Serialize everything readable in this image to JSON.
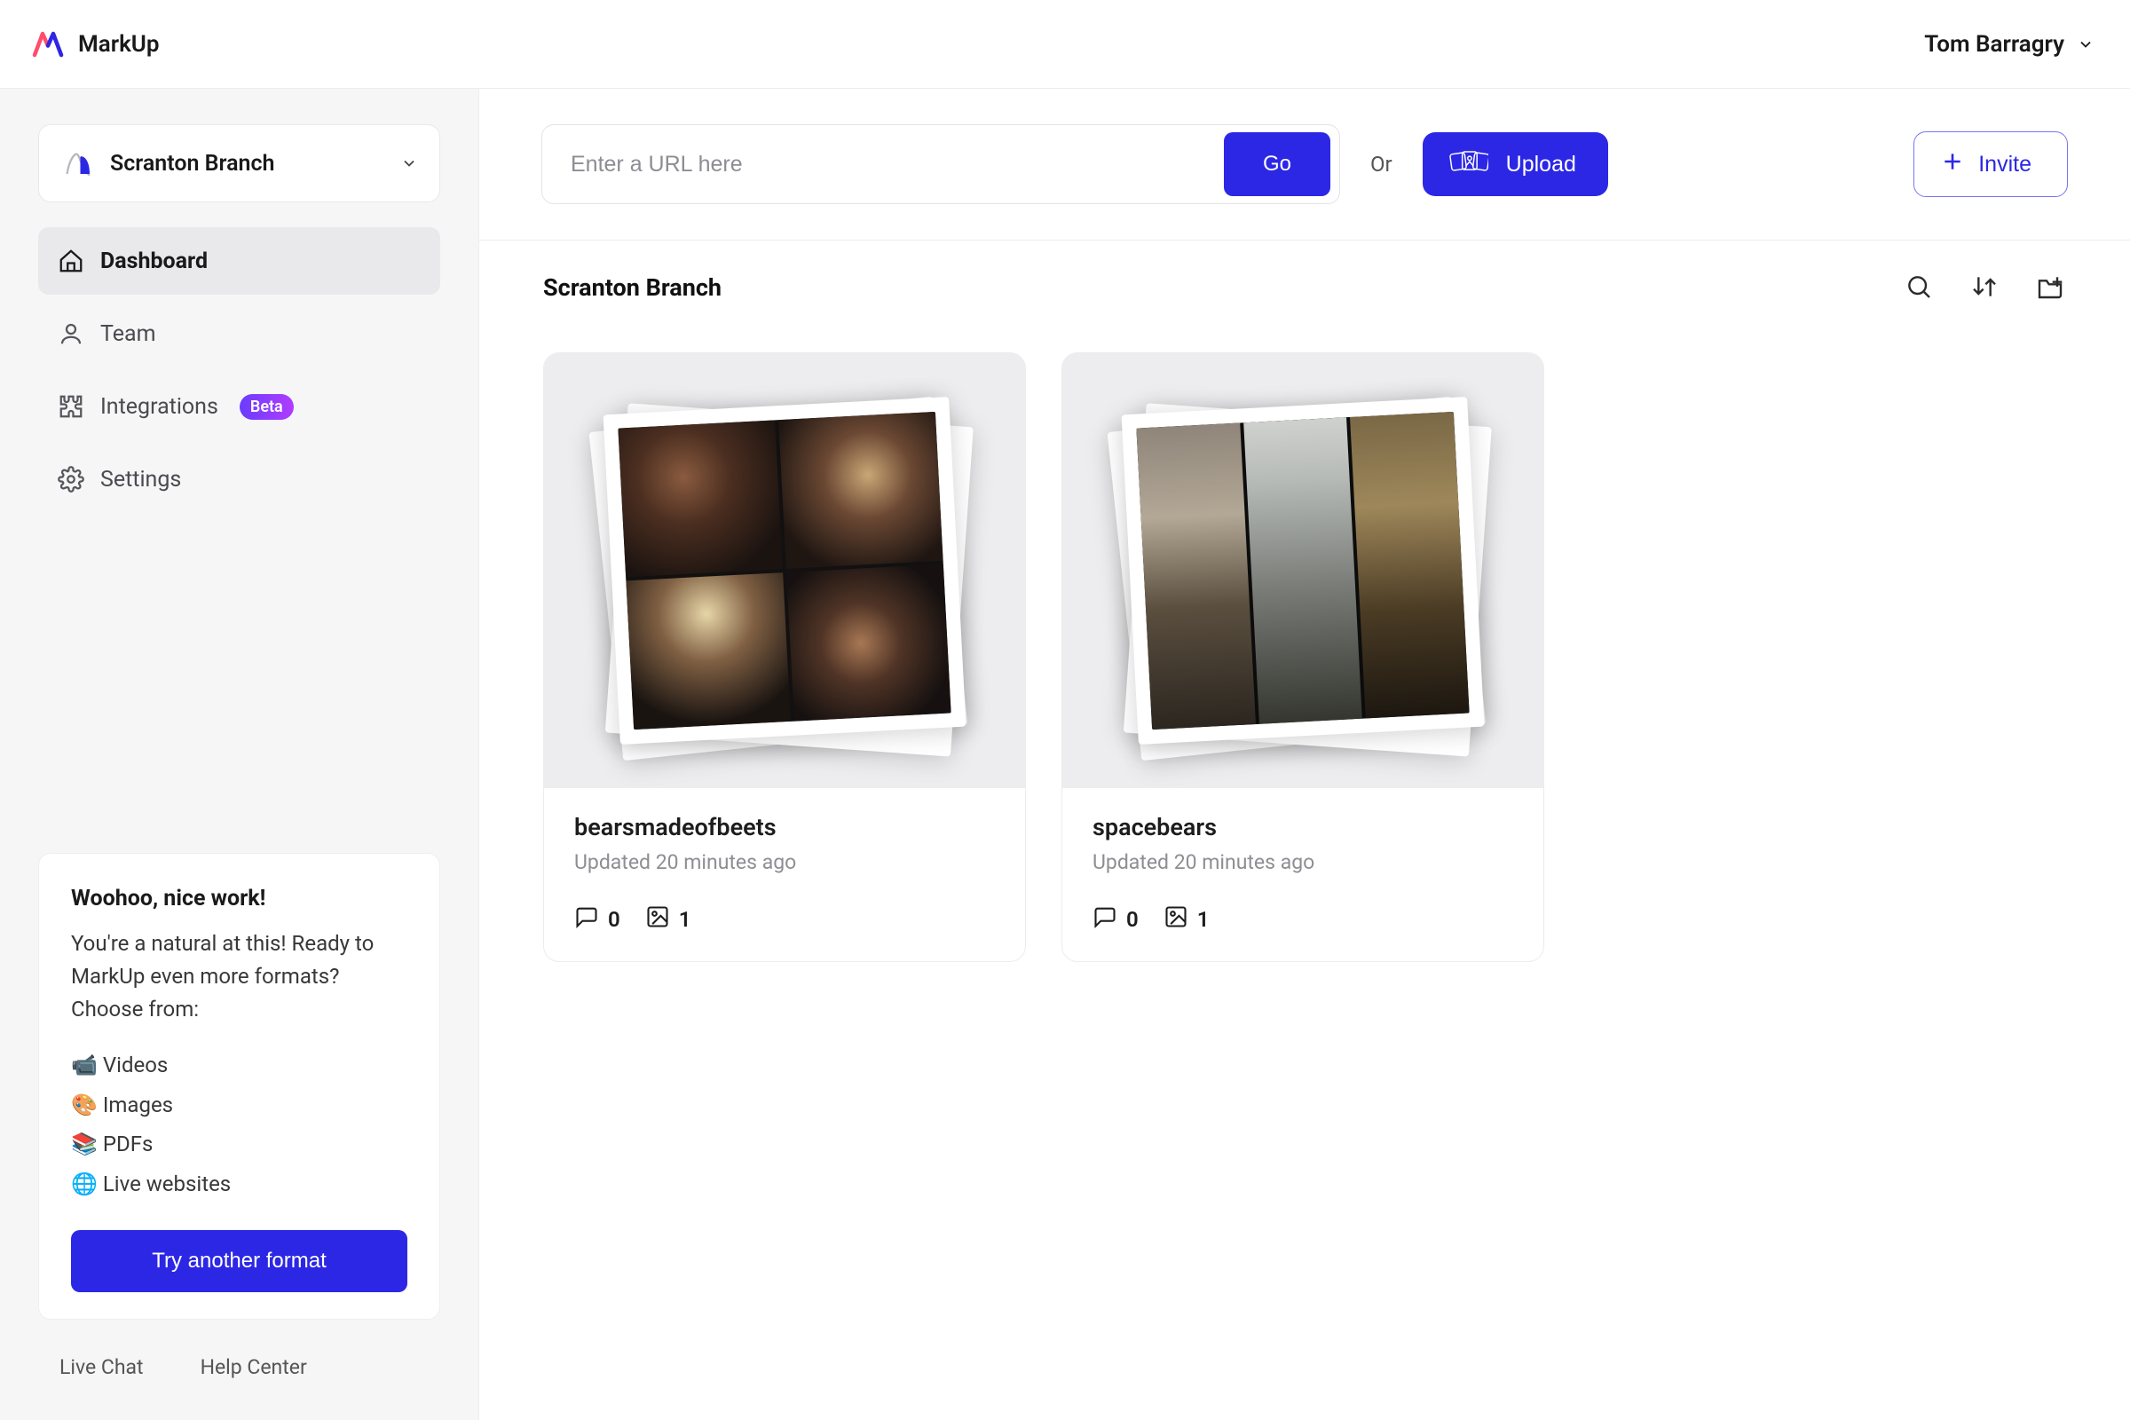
{
  "brand": {
    "name": "MarkUp"
  },
  "user": {
    "name": "Tom Barragry"
  },
  "workspace": {
    "name": "Scranton Branch"
  },
  "nav": {
    "dashboard": "Dashboard",
    "team": "Team",
    "integrations": "Integrations",
    "integrations_badge": "Beta",
    "settings": "Settings"
  },
  "hint": {
    "title": "Woohoo, nice work!",
    "body": "You're a natural at this! Ready to MarkUp even more formats? Choose from:",
    "items": [
      "📹 Videos",
      "🎨 Images",
      "📚 PDFs",
      "🌐 Live websites"
    ],
    "cta": "Try another format"
  },
  "footer": {
    "chat": "Live Chat",
    "help": "Help Center"
  },
  "actionbar": {
    "placeholder": "Enter a URL here",
    "go": "Go",
    "or": "Or",
    "upload": "Upload",
    "invite": "Invite"
  },
  "main": {
    "title": "Scranton Branch"
  },
  "cards": [
    {
      "title": "bearsmadeofbeets",
      "updated": "Updated 20 minutes ago",
      "comments": 0,
      "images": 1
    },
    {
      "title": "spacebears",
      "updated": "Updated 20 minutes ago",
      "comments": 0,
      "images": 1
    }
  ]
}
